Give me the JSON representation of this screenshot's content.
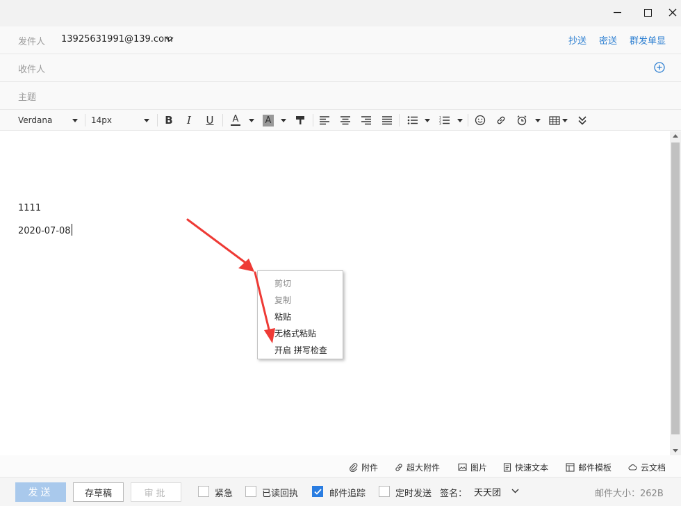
{
  "window": {
    "controls": [
      "minimize-icon",
      "maximize-icon",
      "close-icon"
    ]
  },
  "header": {
    "from_label": "发件人",
    "from_value": "13925631991@139.com",
    "cc_link": "抄送",
    "bcc_link": "密送",
    "single_display_link": "群发单显",
    "to_label": "收件人",
    "subject_label": "主题"
  },
  "toolbar": {
    "font_family": "Verdana",
    "font_size": "14px",
    "bold_glyph": "B",
    "italic_glyph": "I",
    "underline_glyph": "U",
    "font_color_glyph": "A",
    "bg_color_glyph": "A",
    "icons": [
      "bold-icon",
      "italic-icon",
      "underline-icon",
      "font-color-icon",
      "background-color-icon",
      "format-painter-icon",
      "align-left-icon",
      "align-center-icon",
      "align-right-icon",
      "justify-icon",
      "bullet-list-icon",
      "numbered-list-icon",
      "emoji-icon",
      "link-icon",
      "alarm-icon",
      "table-icon",
      "more-icon"
    ]
  },
  "editor": {
    "lines": [
      "1111",
      "2020-07-08"
    ]
  },
  "context_menu": {
    "items": [
      {
        "label": "剪切",
        "enabled": false
      },
      {
        "label": "复制",
        "enabled": false
      },
      {
        "label": "粘贴",
        "enabled": true
      },
      {
        "label": "无格式粘贴",
        "enabled": true
      },
      {
        "label": "开启 拼写检查",
        "enabled": true
      }
    ]
  },
  "attach_bar": {
    "attachment": "附件",
    "large_attachment": "超大附件",
    "image": "图片",
    "quick_text": "快速文本",
    "template": "邮件模板",
    "cloud_doc": "云文档"
  },
  "bottom": {
    "send": "发送",
    "draft": "存草稿",
    "approve": "审批",
    "urgent": {
      "label": "紧急",
      "checked": false
    },
    "read_receipt": {
      "label": "已读回执",
      "checked": false
    },
    "tracking": {
      "label": "邮件追踪",
      "checked": true
    },
    "scheduled": {
      "label": "定时发送",
      "checked": false
    },
    "signature_label": "签名：",
    "signature_value": "天天团",
    "mail_size": "邮件大小：262B"
  },
  "colors": {
    "accent": "#2d7fd1",
    "send_button": "#a9c9ec",
    "annotation_arrow": "#ee3a35"
  }
}
